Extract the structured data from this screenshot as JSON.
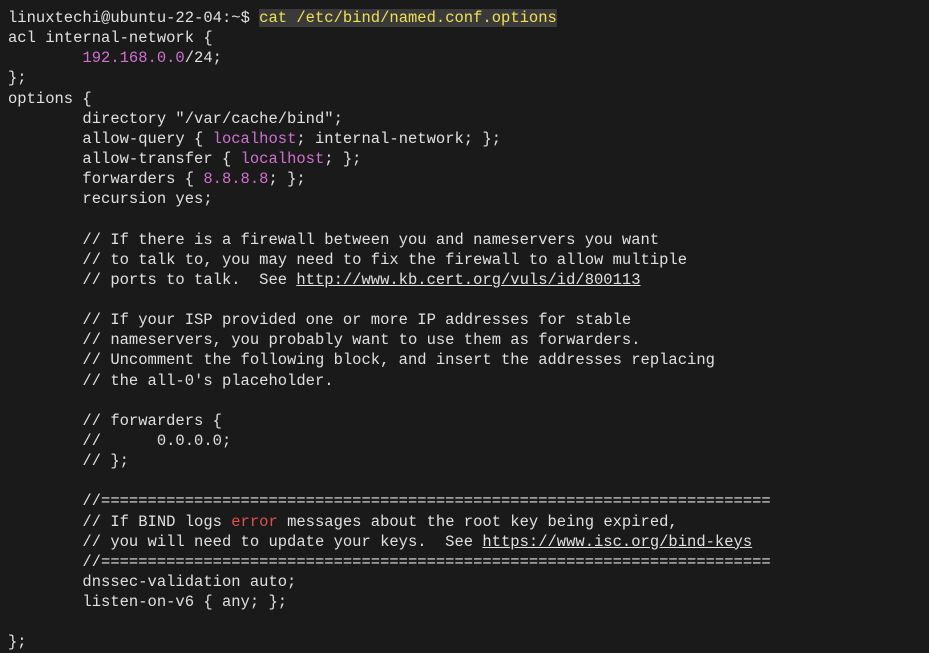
{
  "prompt": {
    "userhost": "linuxtechi@ubuntu-22-04",
    "sep": ":",
    "path": "~",
    "dollar": "$ ",
    "command": "cat /etc/bind/named.conf.options"
  },
  "acl": {
    "header": "acl internal-network {",
    "network_ip": "192.168.0.0",
    "network_suffix": "/24;",
    "close": "};"
  },
  "options": {
    "header": "options {",
    "directory": "directory \"/var/cache/bind\";",
    "allow_query_pre": "allow-query { ",
    "allow_query_kw": "localhost",
    "allow_query_post": "; internal-network; };",
    "allow_transfer_pre": "allow-transfer { ",
    "allow_transfer_kw": "localhost",
    "allow_transfer_post": "; };",
    "forwarders_pre": "forwarders { ",
    "forwarders_ip": "8.8.8.8",
    "forwarders_post": "; };",
    "recursion": "recursion yes;",
    "c1": "// If there is a firewall between you and nameservers you want",
    "c2": "// to talk to, you may need to fix the firewall to allow multiple",
    "c3_pre": "// ports to talk.  See ",
    "c3_url": "http://www.kb.cert.org/vuls/id/800113",
    "c4": "// If your ISP provided one or more IP addresses for stable",
    "c5": "// nameservers, you probably want to use them as forwarders.",
    "c6": "// Uncomment the following block, and insert the addresses replacing",
    "c7": "// the all-0's placeholder.",
    "c8": "// forwarders {",
    "c9": "//      0.0.0.0;",
    "c10": "// };",
    "sep1": "//========================================================================",
    "c11_pre": "// If BIND logs ",
    "c11_err": "error",
    "c11_post": " messages about the root key being expired,",
    "c12_pre": "// you will need to update your keys.  See ",
    "c12_url": "https://www.isc.org/bind-keys",
    "sep2": "//========================================================================",
    "dnssec": "dnssec-validation auto;",
    "listen": "listen-on-v6 { any; };",
    "close": "};"
  }
}
